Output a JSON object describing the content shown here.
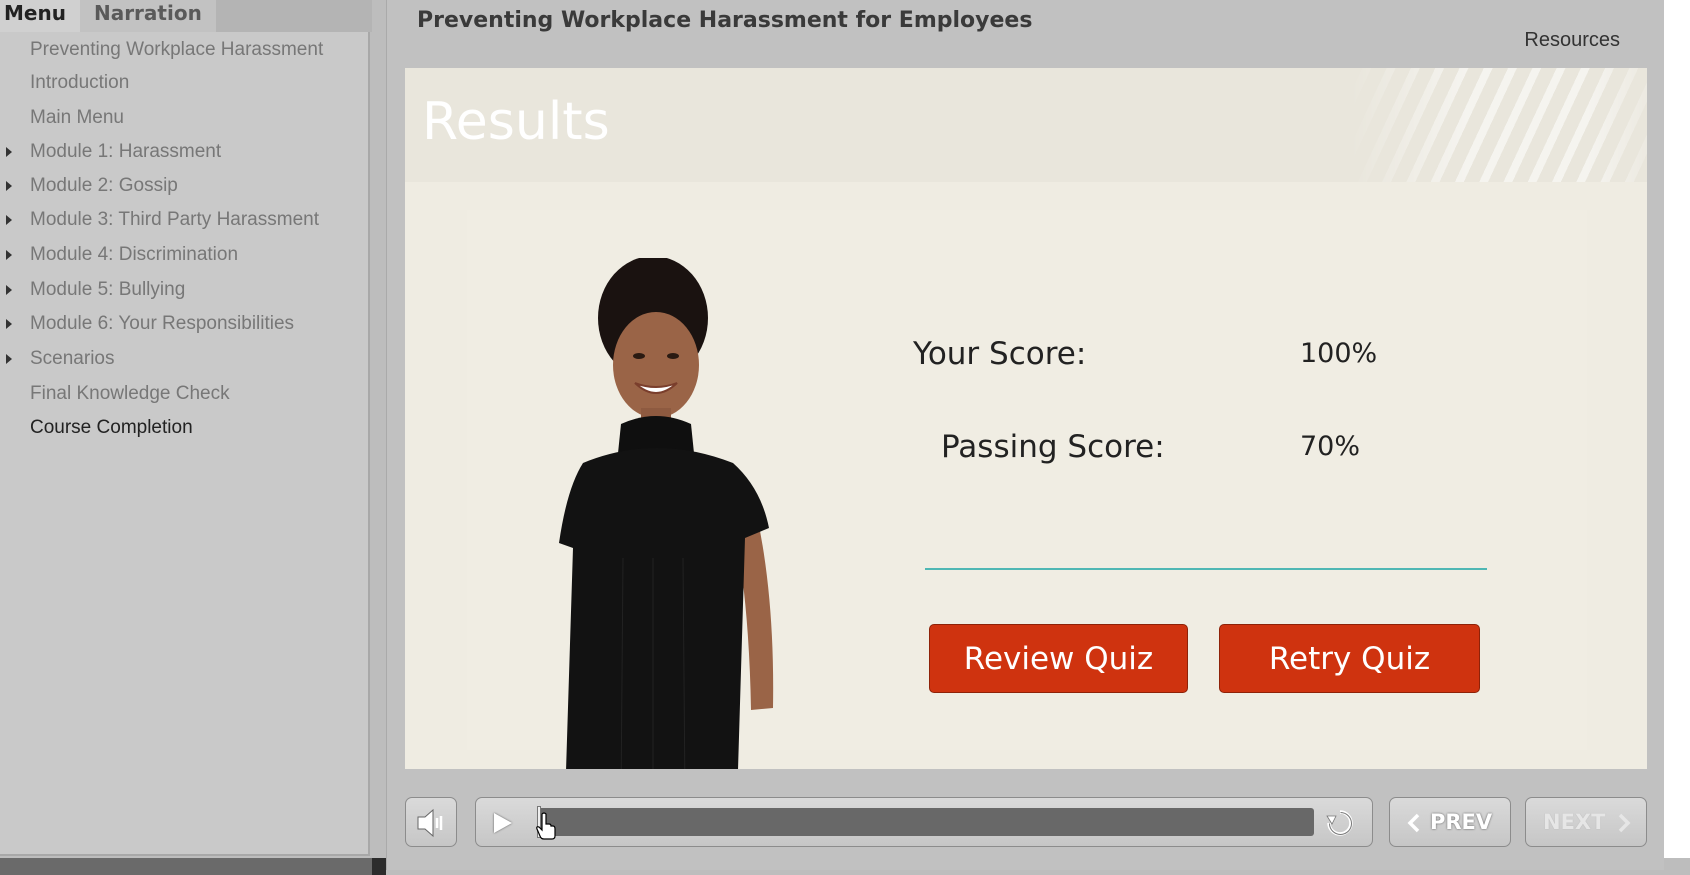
{
  "sidebar": {
    "tabs": [
      {
        "label": "Menu",
        "active": true
      },
      {
        "label": "Narration",
        "active": false
      }
    ],
    "items": [
      {
        "label": "Preventing Workplace Harassment",
        "expandable": false
      },
      {
        "label": "Introduction",
        "expandable": false
      },
      {
        "label": "Main Menu",
        "expandable": false
      },
      {
        "label": "Module 1: Harassment",
        "expandable": true
      },
      {
        "label": "Module 2: Gossip",
        "expandable": true
      },
      {
        "label": "Module 3: Third Party Harassment",
        "expandable": true
      },
      {
        "label": "Module 4: Discrimination",
        "expandable": true
      },
      {
        "label": "Module 5: Bullying",
        "expandable": true
      },
      {
        "label": "Module 6: Your Responsibilities",
        "expandable": true
      },
      {
        "label": "Scenarios",
        "expandable": true
      },
      {
        "label": "Final Knowledge Check",
        "expandable": false
      },
      {
        "label": "Course Completion",
        "expandable": false,
        "current": true
      }
    ]
  },
  "header": {
    "course_title": "Preventing Workplace Harassment for Employees",
    "resources_label": "Resources"
  },
  "slide": {
    "title": "Results",
    "your_score_label": "Your Score:",
    "your_score_value": "100%",
    "passing_score_label": "Passing Score:",
    "passing_score_value": "70%",
    "review_button": "Review Quiz",
    "retry_button": "Retry Quiz"
  },
  "player": {
    "progress_fraction": 0.0,
    "prev_label": "PREV",
    "next_label": "NEXT",
    "next_enabled": false
  },
  "colors": {
    "accent_button": "#cf330f",
    "divider": "#4fb7b4",
    "slide_bg": "#efece2"
  }
}
